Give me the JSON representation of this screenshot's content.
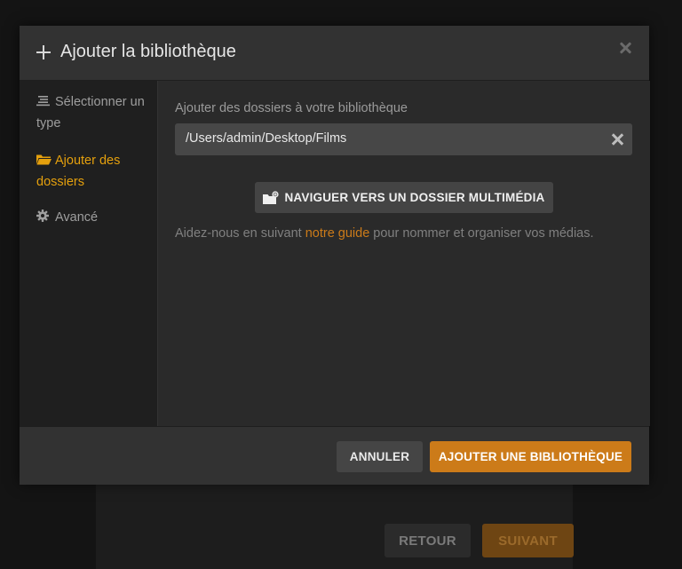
{
  "modal": {
    "title": "Ajouter la bibliothèque",
    "close_icon": "close-icon",
    "header_icon": "plus-icon"
  },
  "sidebar": {
    "items": [
      {
        "label": "Sélectionner un type",
        "icon": "list-icon",
        "active": false
      },
      {
        "label": "Ajouter des dossiers",
        "icon": "folder-open-icon",
        "active": true
      },
      {
        "label": "Avancé",
        "icon": "gear-icon",
        "active": false
      }
    ]
  },
  "folders": {
    "label": "Ajouter des dossiers à votre bibliothèque",
    "path_value": "/Users/admin/Desktop/Films",
    "browse_label": "NAVIGUER VERS UN DOSSIER MULTIMÉDIA",
    "help": {
      "before": "Aidez-nous en suivant ",
      "link": "notre guide",
      "after": " pour nommer et organiser vos médias."
    }
  },
  "footer": {
    "cancel_label": "ANNULER",
    "add_label": "AJOUTER UNE BIBLIOTHÈQUE"
  },
  "background": {
    "back_label": "RETOUR",
    "next_label": "SUIVANT"
  },
  "colors": {
    "accent": "#cc7b19",
    "active_sidebar": "#e5a00d",
    "modal_bg": "#282828",
    "sidebar_bg": "#1f1f1f"
  }
}
